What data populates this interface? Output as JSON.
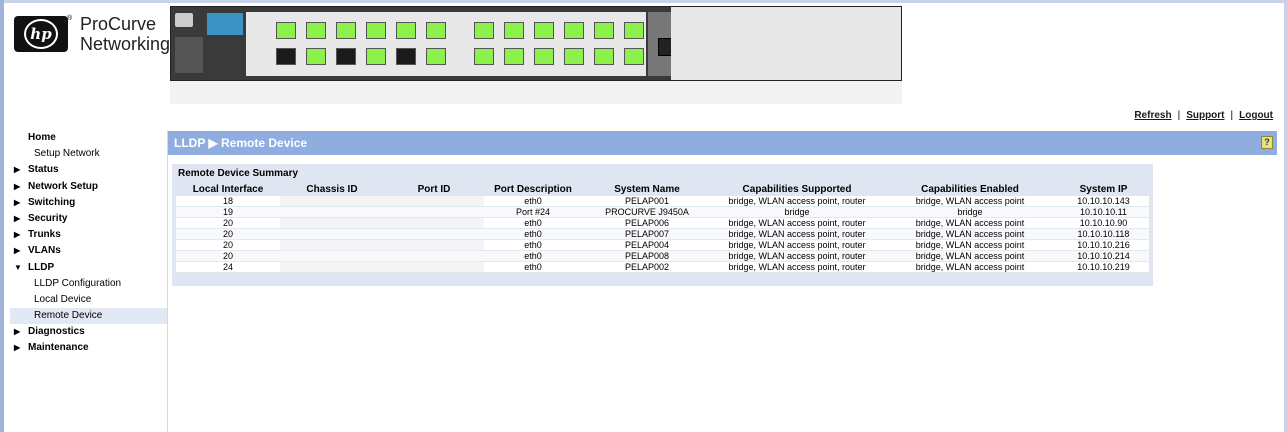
{
  "brand": {
    "logo_text": "hp",
    "reg_mark": "®",
    "name_line1": "ProCurve",
    "name_line2": "Networking"
  },
  "top_links": {
    "refresh": "Refresh",
    "support": "Support",
    "logout": "Logout",
    "sep": "|"
  },
  "sidebar": {
    "items": [
      {
        "label": "Home",
        "level": "top",
        "arrow": ""
      },
      {
        "label": "Setup Network",
        "level": "sub",
        "arrow": ""
      },
      {
        "label": "Status",
        "level": "top",
        "arrow": "▶"
      },
      {
        "label": "Network Setup",
        "level": "top",
        "arrow": "▶"
      },
      {
        "label": "Switching",
        "level": "top",
        "arrow": "▶"
      },
      {
        "label": "Security",
        "level": "top",
        "arrow": "▶"
      },
      {
        "label": "Trunks",
        "level": "top",
        "arrow": "▶"
      },
      {
        "label": "VLANs",
        "level": "top",
        "arrow": "▶"
      },
      {
        "label": "LLDP",
        "level": "top",
        "arrow": "▼"
      },
      {
        "label": "LLDP Configuration",
        "level": "sub",
        "arrow": ""
      },
      {
        "label": "Local Device",
        "level": "sub",
        "arrow": ""
      },
      {
        "label": "Remote Device",
        "level": "sub",
        "arrow": "",
        "selected": true
      },
      {
        "label": "Diagnostics",
        "level": "top",
        "arrow": "▶"
      },
      {
        "label": "Maintenance",
        "level": "top",
        "arrow": "▶"
      }
    ]
  },
  "main": {
    "title": "LLDP ▶ Remote Device",
    "help": "?",
    "summary_title": "Remote Device Summary",
    "columns": [
      "Local Interface",
      "Chassis ID",
      "Port ID",
      "Port Description",
      "System Name",
      "Capabilities Supported",
      "Capabilities Enabled",
      "System IP"
    ],
    "rows": [
      [
        "18",
        "",
        "",
        "eth0",
        "PELAP001",
        "bridge, WLAN access point, router",
        "bridge, WLAN access point",
        "10.10.10.143"
      ],
      [
        "19",
        "",
        "",
        "Port #24",
        "PROCURVE J9450A",
        "bridge",
        "bridge",
        "10.10.10.11"
      ],
      [
        "20",
        "",
        "",
        "eth0",
        "PELAP006",
        "bridge, WLAN access point, router",
        "bridge, WLAN access point",
        "10.10.10.90"
      ],
      [
        "20",
        "",
        "",
        "eth0",
        "PELAP007",
        "bridge, WLAN access point, router",
        "bridge, WLAN access point",
        "10.10.10.118"
      ],
      [
        "20",
        "",
        "",
        "eth0",
        "PELAP004",
        "bridge, WLAN access point, router",
        "bridge, WLAN access point",
        "10.10.10.216"
      ],
      [
        "20",
        "",
        "",
        "eth0",
        "PELAP008",
        "bridge, WLAN access point, router",
        "bridge, WLAN access point",
        "10.10.10.214"
      ],
      [
        "24",
        "",
        "",
        "eth0",
        "PELAP002",
        "bridge, WLAN access point, router",
        "bridge, WLAN access point",
        "10.10.10.219"
      ]
    ]
  },
  "colors": {
    "accent_bar": "#8faedf",
    "port_link": "#8ef04a",
    "port_dark": "#1a1a1a"
  },
  "switch_image": {
    "ports": [
      "link",
      "link",
      "link",
      "link",
      "link",
      "link",
      "link",
      "link",
      "link",
      "link",
      "link",
      "link",
      "dark",
      "link",
      "dark",
      "link",
      "dark",
      "link",
      "link",
      "link",
      "link",
      "link",
      "link",
      "link"
    ]
  }
}
